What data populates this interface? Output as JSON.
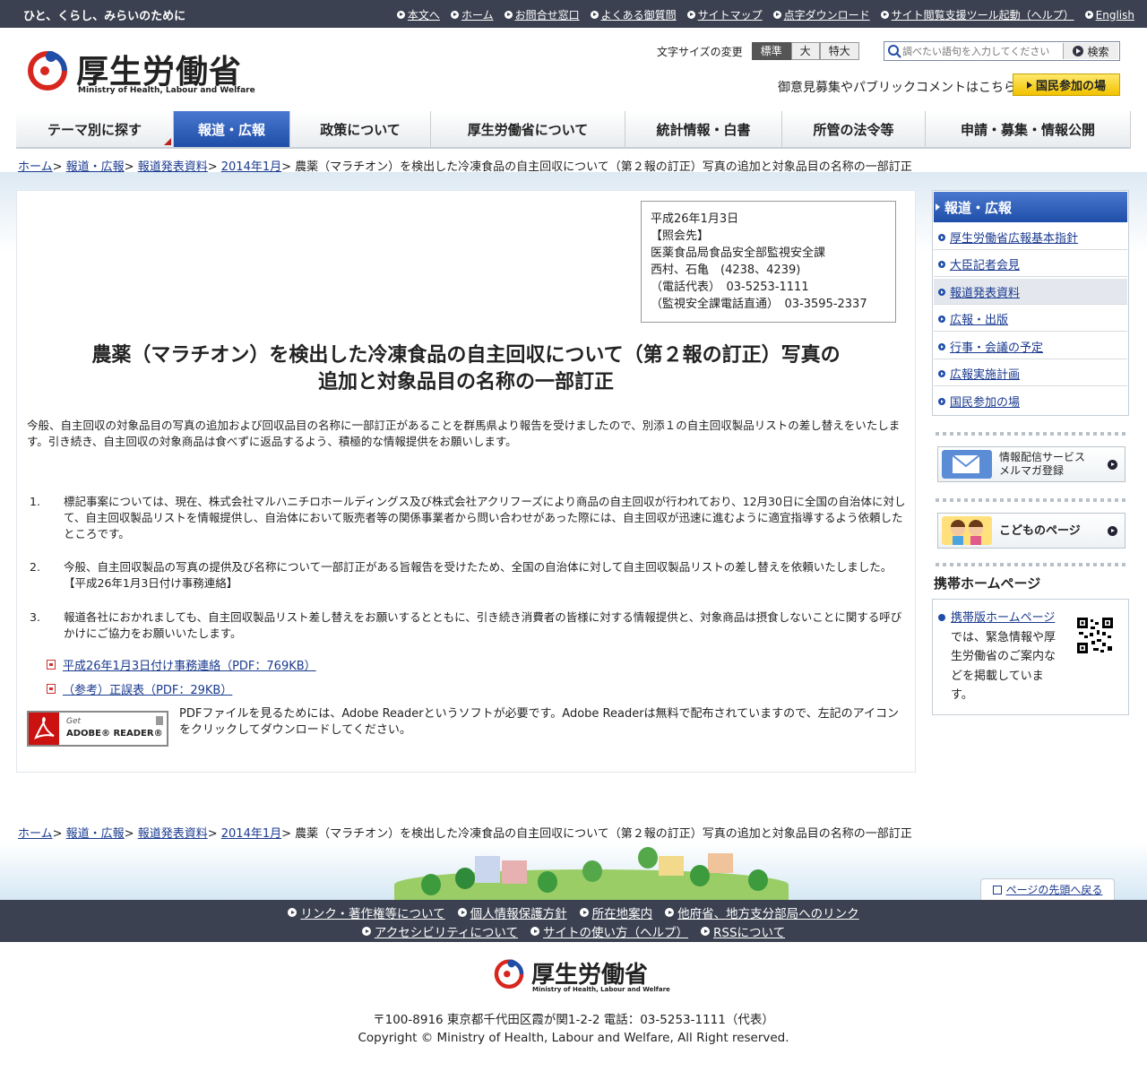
{
  "top": {
    "tagline": "ひと、くらし、みらいのために",
    "links": [
      "本文へ",
      "ホーム",
      "お問合せ窓口",
      "よくある御質問",
      "サイトマップ",
      "点字ダウンロード",
      "サイト閲覧支援ツール起動（ヘルプ）",
      "English"
    ]
  },
  "logo": {
    "name": "厚生労働省",
    "en": "Ministry of Health, Labour and Welfare"
  },
  "fontsize": {
    "label": "文字サイズの変更",
    "options": [
      "標準",
      "大",
      "特大"
    ],
    "selected": "標準"
  },
  "search": {
    "placeholder": "調べたい語句を入力してください",
    "button": "検索"
  },
  "opinion": "御意見募集やパブリックコメントはこちら",
  "kokumin": "国民参加の場",
  "gnav": [
    "テーマ別に探す",
    "報道・広報",
    "政策について",
    "厚生労働省について",
    "統計情報・白書",
    "所管の法令等",
    "申請・募集・情報公開"
  ],
  "breadcrumb": {
    "items": [
      "ホーム",
      "報道・広報",
      "報道発表資料",
      "2014年1月"
    ],
    "current": "農薬（マラチオン）を検出した冷凍食品の自主回収について（第２報の訂正）写真の追加と対象品目の名称の一部訂正"
  },
  "contact": {
    "lines": [
      "平成26年1月3日",
      "【照会先】",
      "医薬食品局食品安全部監視安全課",
      "西村、石亀　(4238、4239)",
      "（電話代表）　03-5253-1111",
      "（監視安全課電話直通）　03-3595-2337"
    ]
  },
  "article": {
    "title_line1": "農薬（マラチオン）を検出した冷凍食品の自主回収について（第２報の訂正）写真の",
    "title_line2": "追加と対象品目の名称の一部訂正",
    "lead": "今般、自主回収の対象品目の写真の追加および回収品目の名称に一部訂正があることを群馬県より報告を受けましたので、別添１の自主回収製品リストの差し替えをいたします。引き続き、自主回収の対象商品は食べずに返品するよう、積極的な情報提供をお願いします。",
    "items": [
      {
        "num": "1.",
        "text": "標記事案については、現在、株式会社マルハニチロホールディングス及び株式会社アクリフーズにより商品の自主回収が行われており、12月30日に全国の自治体に対して、自主回収製品リストを情報提供し、自治体において販売者等の関係事業者から問い合わせがあった際には、自主回収が迅速に進むように適宜指導するよう依頼したところです。"
      },
      {
        "num": "2.",
        "text": "今般、自主回収製品の写真の提供及び名称について一部訂正がある旨報告を受けたため、全国の自治体に対して自主回収製品リストの差し替えを依頼いたしました。【平成26年1月3日付け事務連絡】"
      },
      {
        "num": "3.",
        "text": "報道各社におかれましても、自主回収製品リスト差し替えをお願いするとともに、引き続き消費者の皆様に対する情報提供と、対象商品は摂食しないことに関する呼びかけにご協力をお願いいたします。"
      }
    ],
    "pdfs": [
      "平成26年1月3日付け事務連絡（PDF：769KB）",
      "（参考）正誤表（PDF：29KB）"
    ],
    "adobe_get": "Get",
    "adobe_name": "ADOBE® READER®",
    "adobe_text": "PDFファイルを見るためには、Adobe Readerというソフトが必要です。Adobe Readerは無料で配布されていますので、左記のアイコンをクリックしてダウンロードしてください。"
  },
  "sidebar": {
    "heading": "報道・広報",
    "items": [
      "厚生労働省広報基本指針",
      "大臣記者会見",
      "報道発表資料",
      "広報・出版",
      "行事・会議の予定",
      "広報実施計画",
      "国民参加の場"
    ],
    "active": 2,
    "banner1": [
      "情報配信サービス",
      "メルマガ登録"
    ],
    "banner2": "こどものページ",
    "mobile_heading": "携帯ホームページ",
    "mobile_link": "携帯版ホームページ",
    "mobile_text": "では、緊急情報や厚生労働省のご案内などを掲載しています。"
  },
  "totop": "ページの先頭へ戻る",
  "footer": {
    "row1": [
      "リンク・著作権等について",
      "個人情報保護方針",
      "所在地案内",
      "他府省、地方支分部局へのリンク"
    ],
    "row2": [
      "アクセシビリティについて",
      "サイトの使い方（ヘルプ）",
      "RSSについて"
    ],
    "address": "〒100-8916 東京都千代田区霞が関1-2-2 電話：03-5253-1111（代表）",
    "copyright": "Copyright © Ministry of Health, Labour and Welfare, All Right reserved."
  }
}
